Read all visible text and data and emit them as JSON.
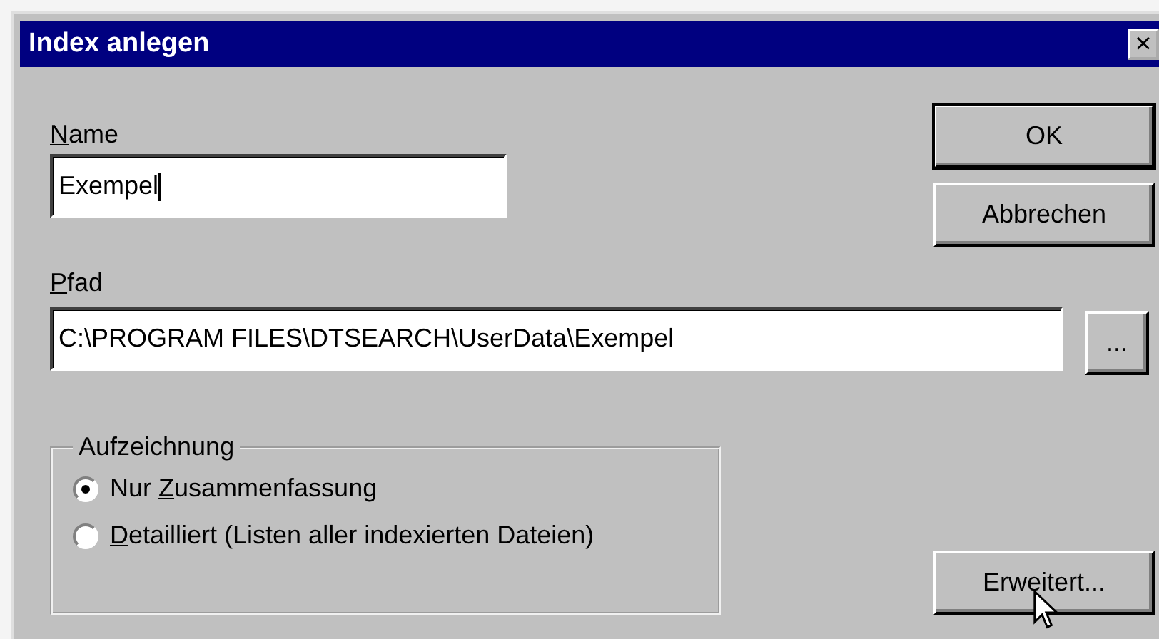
{
  "window": {
    "title": "Index anlegen",
    "close_label": "×"
  },
  "name_field": {
    "label": {
      "key": "N",
      "after": "ame"
    },
    "value": "Exempel"
  },
  "path_field": {
    "label": {
      "key": "P",
      "after": "fad"
    },
    "value": "C:\\PROGRAM FILES\\DTSEARCH\\UserData\\Exempel",
    "browse_label": "..."
  },
  "buttons": {
    "ok": "OK",
    "cancel": "Abbrechen",
    "advanced": "Erweitert..."
  },
  "logging": {
    "title": "Aufzeichnung",
    "options": [
      {
        "label": {
          "before": "Nur ",
          "key": "Z",
          "after": "usammenfassung"
        },
        "selected": true
      },
      {
        "label": {
          "key": "D",
          "after": "etailliert (Listen aller indexierten Dateien)"
        },
        "selected": false
      }
    ]
  }
}
